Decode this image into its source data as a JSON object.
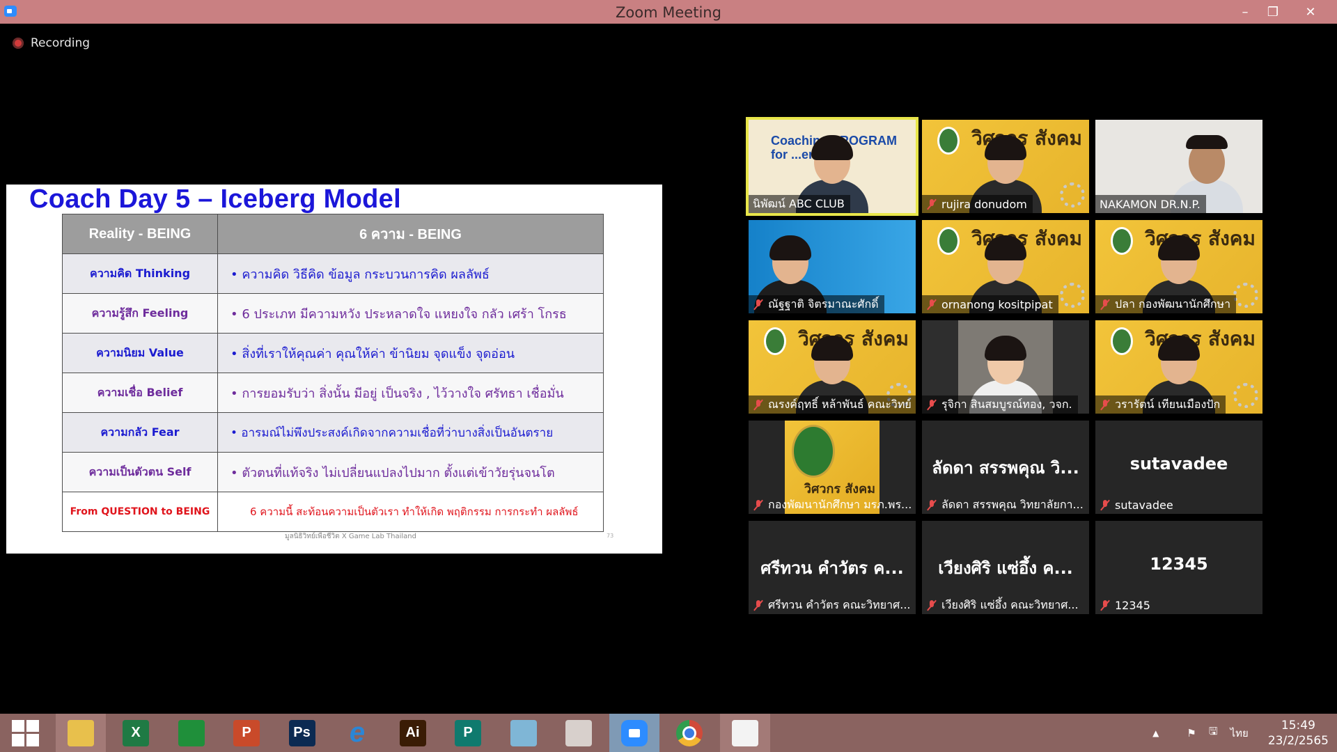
{
  "window": {
    "title": "Zoom Meeting"
  },
  "recording": {
    "label": "Recording"
  },
  "slide": {
    "title": "Coach Day 5 – Iceberg Model",
    "headers": [
      "Reality - BEING",
      "6 ความ - BEING"
    ],
    "rows": [
      {
        "label": "ความคิด Thinking",
        "text": "• ความคิด วิธีคิด ข้อมูล กระบวนการคิด ผลลัพธ์"
      },
      {
        "label": "ความรู้สึก Feeling",
        "text": "• 6 ประเภท มีความหวัง ประหลาดใจ แหยงใจ กลัว เศร้า โกรธ"
      },
      {
        "label": "ความนิยม Value",
        "text": "• สิ่งที่เราให้คุณค่า คุณให้ค่า ข้านิยม จุดแข็ง จุดอ่อน"
      },
      {
        "label": "ความเชื่อ Belief",
        "text": "• การยอมรับว่า สิ่งนั้น มีอยู่ เป็นจริง , ไว้วางใจ ศรัทธา เชื่อมั่น"
      },
      {
        "label": "ความกลัว Fear",
        "text": "• อารมณ์ไม่พึงประสงค์เกิดจากความเชื่อที่ว่าบางสิ่งเป็นอันตราย"
      },
      {
        "label": "ความเป็นตัวตน Self",
        "text": "• ตัวตนที่แท้จริง ไม่เปลี่ยนแปลงไปมาก ตั้งแต่เข้าวัยรุ่นจนโต"
      }
    ],
    "last_row": {
      "label": "From QUESTION to BEING",
      "text": "6 ความนี้ สะท้อนความเป็นตัวเรา ทำให้เกิด พฤติกรรม การกระทำ ผลลัพธ์"
    },
    "footer": "มูลนิธิวิทย์เพื่อชีวิต X Game Lab Thailand",
    "page_number": "73"
  },
  "participants": [
    {
      "name": "นิพัฒน์ ABC CLUB",
      "style": "coach",
      "muted": false,
      "active": true,
      "bg_text": "Coaching PROGRAM for ...er"
    },
    {
      "name": "rujira donudom",
      "style": "poster",
      "muted": true,
      "active": false
    },
    {
      "name": "NAKAMON DR.N.P.",
      "style": "white",
      "muted": false,
      "active": false
    },
    {
      "name": "ณัฐฐาติ จิตรมาณะศักดิ์",
      "style": "blue",
      "muted": true,
      "active": false
    },
    {
      "name": "ornanong kositpipat",
      "style": "poster",
      "muted": true,
      "active": false
    },
    {
      "name": "ปลา กองพัฒนานักศึกษา",
      "style": "poster",
      "muted": true,
      "active": false
    },
    {
      "name": "ณรงค์ฤทธิ์ หล้าพันธ์ คณะวิทย์",
      "style": "poster",
      "muted": true,
      "active": false
    },
    {
      "name": "รุจิกา สินสมบูรณ์ทอง, วจก.",
      "style": "office",
      "muted": true,
      "active": false
    },
    {
      "name": "วรารัตน์ เทียนเมืองปัก",
      "style": "poster",
      "muted": true,
      "active": false
    },
    {
      "name": "กองพัฒนานักศึกษา มรภ.พร...",
      "style": "smallposter",
      "muted": true,
      "active": false
    },
    {
      "name": "ลัดดา สรรพคุณ วิทยาลัยกา...",
      "style": "text",
      "muted": true,
      "active": false,
      "display": "ลัดดา สรรพคุณ วิ..."
    },
    {
      "name": "sutavadee",
      "style": "text",
      "muted": true,
      "active": false,
      "display": "sutavadee"
    },
    {
      "name": "ศรีทวน คำวัตร คณะวิทยาศ...",
      "style": "text",
      "muted": true,
      "active": false,
      "display": "ศรีทวน คำวัตร ค..."
    },
    {
      "name": "เวียงศิริ แซ่อึ้ง คณะวิทยาศ...",
      "style": "text",
      "muted": true,
      "active": false,
      "display": "เวียงศิริ แซ่อึ้ง ค..."
    },
    {
      "name": "12345",
      "style": "text",
      "muted": true,
      "active": false,
      "display": "12345"
    }
  ],
  "poster_text": "วิศวกร สังคม",
  "taskbar": {
    "apps": [
      {
        "id": "start",
        "label": ""
      },
      {
        "id": "file-explorer",
        "label": ""
      },
      {
        "id": "excel",
        "label": "X",
        "color": "#1f7a44"
      },
      {
        "id": "store",
        "label": "",
        "color": "#1f8f3a"
      },
      {
        "id": "powerpoint",
        "label": "P",
        "color": "#c94a2a"
      },
      {
        "id": "photoshop",
        "label": "Ps",
        "color": "#0b2a52"
      },
      {
        "id": "internet-explorer",
        "label": "e",
        "color": "#2b86d6"
      },
      {
        "id": "illustrator",
        "label": "Ai",
        "color": "#3a1c05"
      },
      {
        "id": "publisher",
        "label": "P",
        "color": "#0f7a6e"
      },
      {
        "id": "notepad",
        "label": "",
        "color": "#7fb6d6"
      },
      {
        "id": "photoscape",
        "label": "",
        "color": "#d8d0cc"
      },
      {
        "id": "zoom",
        "label": "",
        "color": "#2d8cff"
      },
      {
        "id": "chrome",
        "label": "",
        "color": "#d14a3a"
      },
      {
        "id": "image-app",
        "label": "",
        "color": "#f3f3f3"
      }
    ],
    "language": "ไทย",
    "time": "15:49",
    "date": "23/2/2565"
  }
}
